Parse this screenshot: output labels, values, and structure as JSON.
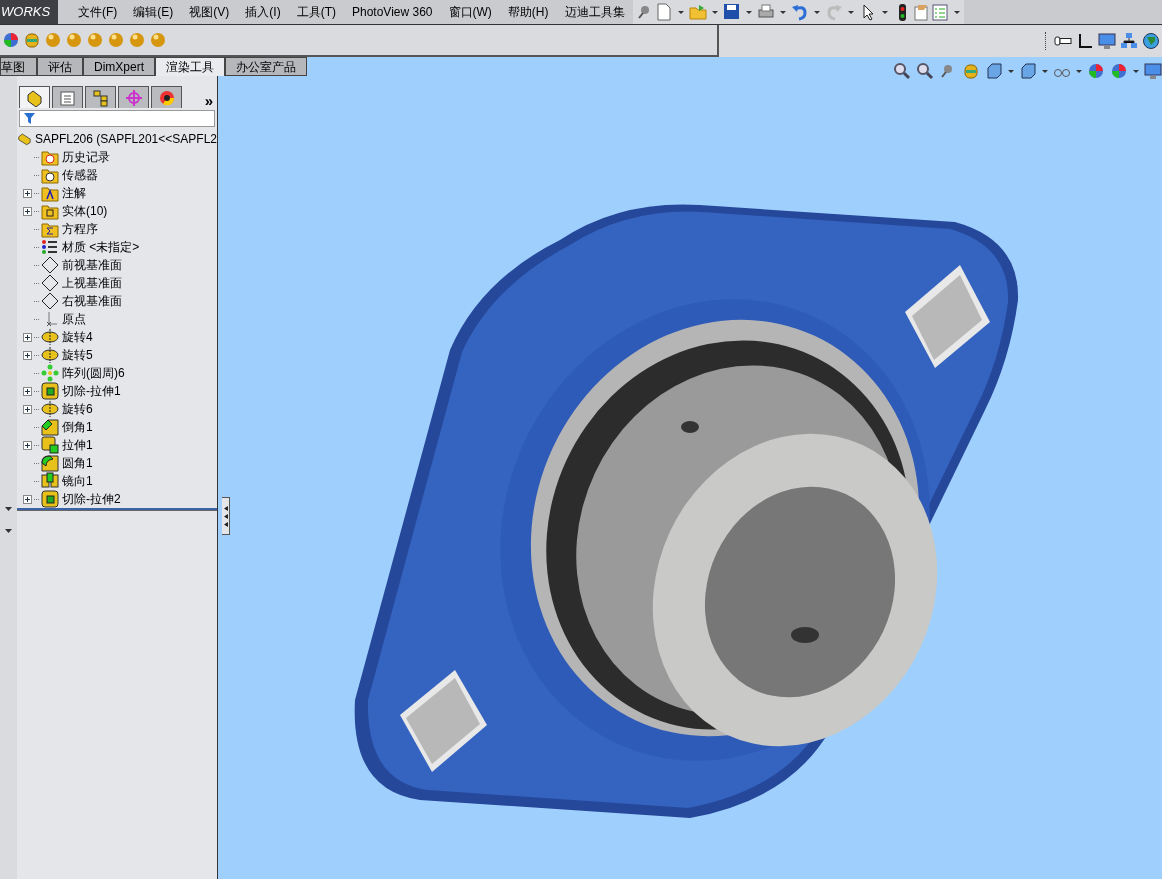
{
  "app_logo": "WORKS",
  "menu": [
    "文件(F)",
    "编辑(E)",
    "视图(V)",
    "插入(I)",
    "工具(T)",
    "PhotoView 360",
    "窗口(W)",
    "帮助(H)",
    "迈迪工具集"
  ],
  "tabs": [
    {
      "label": "草图",
      "selected": false
    },
    {
      "label": "评估",
      "selected": false
    },
    {
      "label": "DimXpert",
      "selected": false
    },
    {
      "label": "渲染工具",
      "selected": true
    },
    {
      "label": "办公室产品",
      "selected": false
    }
  ],
  "panel_tabs": [
    {
      "kind": "feature",
      "selected": true
    },
    {
      "kind": "property",
      "selected": false
    },
    {
      "kind": "config",
      "selected": false
    },
    {
      "kind": "dim",
      "selected": false
    },
    {
      "kind": "display",
      "selected": false
    }
  ],
  "panel_more": "»",
  "tree": {
    "root": "SAPFL206  (SAPFL201<<SAPFL2",
    "items": [
      {
        "kind": "history",
        "label": "历史记录"
      },
      {
        "kind": "sensor",
        "label": "传感器"
      },
      {
        "kind": "annotation",
        "label": "注解",
        "expanded": false
      },
      {
        "kind": "body",
        "label": "实体(10)",
        "expanded": false
      },
      {
        "kind": "equation",
        "label": "方程序"
      },
      {
        "kind": "material",
        "label": "材质 <未指定>"
      },
      {
        "kind": "plane",
        "label": "前视基准面"
      },
      {
        "kind": "plane",
        "label": "上视基准面"
      },
      {
        "kind": "plane",
        "label": "右视基准面"
      },
      {
        "kind": "origin",
        "label": "原点"
      },
      {
        "kind": "revolve",
        "label": "旋转4",
        "expanded": false
      },
      {
        "kind": "revolve",
        "label": "旋转5",
        "expanded": false
      },
      {
        "kind": "pattern",
        "label": "阵列(圆周)6"
      },
      {
        "kind": "cut",
        "label": "切除-拉伸1",
        "expanded": false
      },
      {
        "kind": "revolve",
        "label": "旋转6",
        "expanded": false
      },
      {
        "kind": "chamfer",
        "label": "倒角1"
      },
      {
        "kind": "extrude",
        "label": "拉伸1",
        "expanded": false
      },
      {
        "kind": "fillet",
        "label": "圆角1"
      },
      {
        "kind": "mirror",
        "label": "镜向1"
      },
      {
        "kind": "cut",
        "label": "切除-拉伸2",
        "expanded": false
      }
    ]
  }
}
